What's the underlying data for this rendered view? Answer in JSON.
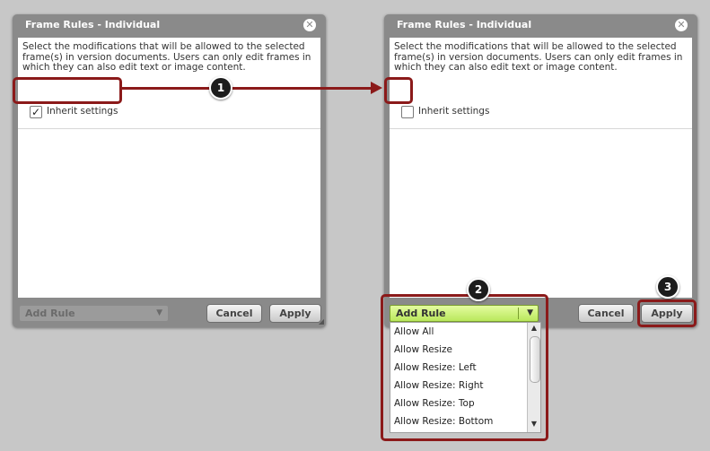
{
  "dialog_left": {
    "title": "Frame Rules - Individual",
    "close_icon": "✕",
    "description": "Select the modifications that will be allowed to the selected frame(s) in version documents. Users can only edit frames in which they can also edit text or image content.",
    "inherit_label": "Inherit settings",
    "inherit_checked": "✓",
    "add_rule_label": "Add Rule",
    "cancel_label": "Cancel",
    "apply_label": "Apply"
  },
  "dialog_right": {
    "title": "Frame Rules - Individual",
    "close_icon": "✕",
    "description": "Select the modifications that will be allowed to the selected frame(s) in version documents. Users can only edit frames in which they can also edit text or image content.",
    "inherit_label": "Inherit settings",
    "add_rule_label": "Add Rule",
    "cancel_label": "Cancel",
    "apply_label": "Apply"
  },
  "dropdown_options": [
    "Allow All",
    "Allow Resize",
    "Allow Resize: Left",
    "Allow Resize: Right",
    "Allow Resize: Top",
    "Allow Resize: Bottom"
  ],
  "callouts": [
    "1",
    "2",
    "3"
  ],
  "colors": {
    "highlight": "#8b1a1a",
    "dialog_frame": "#8a8a8a",
    "active_select": "#c6f074"
  }
}
